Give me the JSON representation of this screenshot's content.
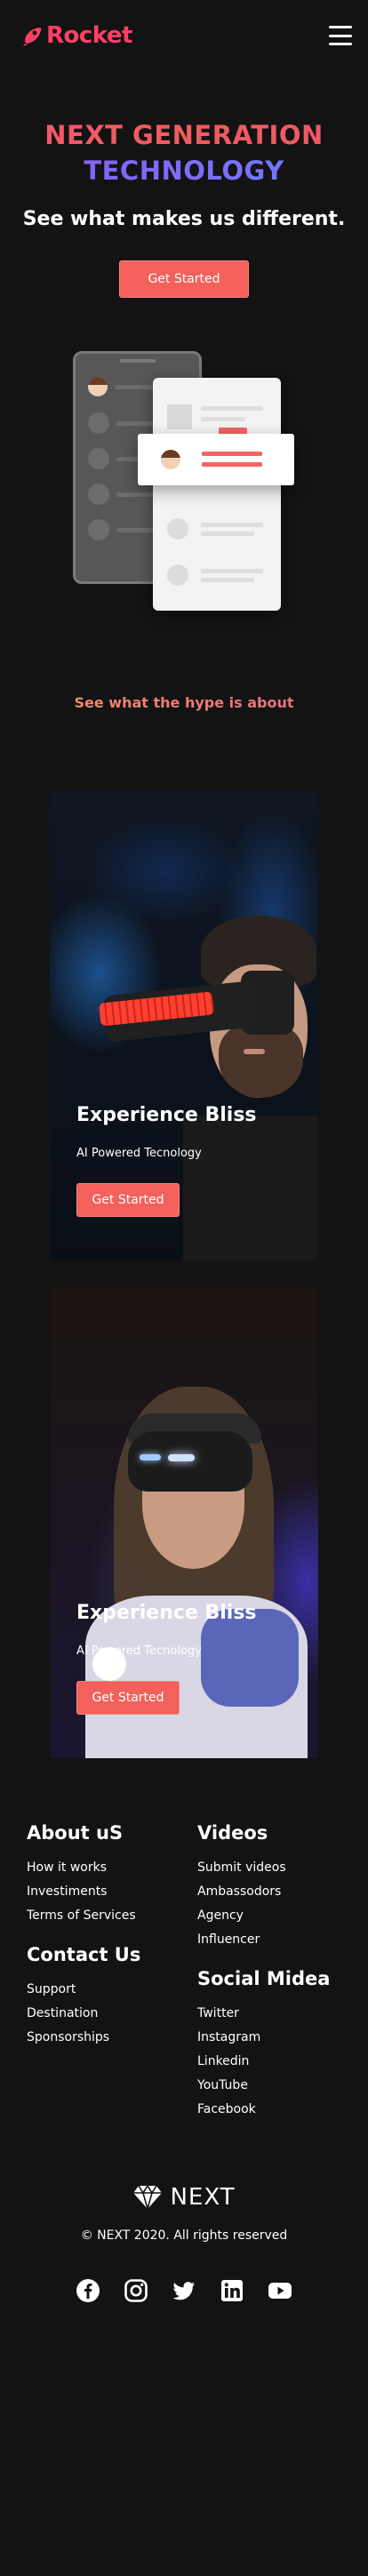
{
  "nav": {
    "brand": "Rocket",
    "menu_icon": "hamburger-menu-icon"
  },
  "hero": {
    "title_line1": "NEXT GENERATION",
    "title_line2": "TECHNOLOGY",
    "subtitle": "See what makes us different.",
    "cta_label": "Get Started"
  },
  "hype": {
    "title": "See what the hype is about"
  },
  "features": [
    {
      "title": "Experience Bliss",
      "subtitle": "AI Powered Tecnology",
      "cta_label": "Get Started"
    },
    {
      "title": "Experience Bliss",
      "subtitle": "AI Powered Tecnology",
      "cta_label": "Get Started"
    }
  ],
  "footer": {
    "about": {
      "heading": "About uS",
      "links": [
        "How it works",
        "Investiments",
        "Terms of Services"
      ]
    },
    "videos": {
      "heading": "Videos",
      "links": [
        "Submit videos",
        "Ambassodors",
        "Agency",
        "Influencer"
      ]
    },
    "contact": {
      "heading": "Contact Us",
      "links": [
        "Support",
        "Destination",
        "Sponsorships"
      ]
    },
    "social": {
      "heading": "Social Midea",
      "links": [
        "Twitter",
        "Instagram",
        "Linkedin",
        "YouTube",
        "Facebook"
      ]
    },
    "brand": "NEXT",
    "copyright": "© NEXT 2020. All rights reserved",
    "social_icons": [
      "facebook-icon",
      "instagram-icon",
      "twitter-icon",
      "linkedin-icon",
      "youtube-icon"
    ]
  },
  "colors": {
    "background": "#131313",
    "accent": "#f2615b",
    "brand": "#ff3f66",
    "gradient_blue": "#6f7cff"
  }
}
